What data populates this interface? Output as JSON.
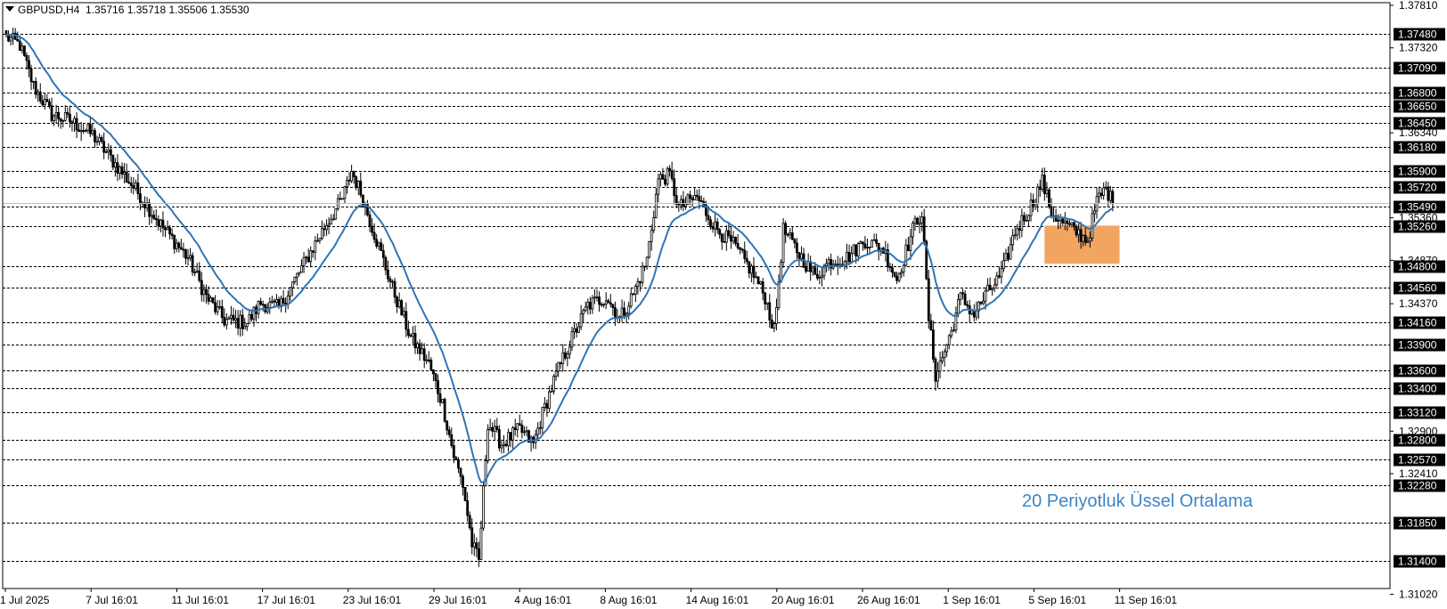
{
  "header": {
    "symbol": "GBPUSD,H4",
    "ohlc": "1.35716 1.35718 1.35506 1.35530"
  },
  "annotation": {
    "text": "20 Periyotluk Üssel Ortalama"
  },
  "colors": {
    "background": "#ffffff",
    "candle": "#000000",
    "ema_line": "#2e75b6",
    "annotation_text": "#3d85c6",
    "highlight_box": "#f2a561",
    "level_line": "#000000",
    "badge_bg": "#000000",
    "badge_text": "#ffffff"
  },
  "chart_data": {
    "type": "candlestick",
    "symbol": "GBPUSD",
    "timeframe": "H4",
    "ylim": [
      1.3125,
      1.3781
    ],
    "grid": false,
    "x_ticks": [
      "1 Jul 2025",
      "7 Jul 16:01",
      "11 Jul 16:01",
      "17 Jul 16:01",
      "23 Jul 16:01",
      "29 Jul 16:01",
      "4 Aug 16:01",
      "8 Aug 16:01",
      "14 Aug 16:01",
      "20 Aug 16:01",
      "26 Aug 16:01",
      "1 Sep 16:01",
      "5 Sep 16:01",
      "11 Sep 16:01"
    ],
    "y_ticks": [
      "1.37810",
      "1.37320",
      "1.36340",
      "1.35360",
      "1.34870",
      "1.34370",
      "1.32900",
      "1.32410",
      "1.31020"
    ],
    "level_labels": [
      "1.37480",
      "1.37090",
      "1.36800",
      "1.36650",
      "1.36450",
      "1.36180",
      "1.35900",
      "1.35720",
      "1.35490",
      "1.35260",
      "1.34800",
      "1.34560",
      "1.34160",
      "1.33900",
      "1.33600",
      "1.33400",
      "1.33120",
      "1.32800",
      "1.32570",
      "1.32280",
      "1.31850",
      "1.31400"
    ],
    "current_price": 1.3553,
    "close_path": [
      [
        0,
        1.3745
      ],
      [
        6,
        1.3735
      ],
      [
        12,
        1.3688
      ],
      [
        20,
        1.3655
      ],
      [
        28,
        1.3648
      ],
      [
        38,
        1.3632
      ],
      [
        48,
        1.3598
      ],
      [
        58,
        1.3565
      ],
      [
        68,
        1.3528
      ],
      [
        80,
        1.349
      ],
      [
        88,
        1.3445
      ],
      [
        96,
        1.3418
      ],
      [
        106,
        1.3415
      ],
      [
        112,
        1.3438
      ],
      [
        120,
        1.3432
      ],
      [
        130,
        1.3478
      ],
      [
        140,
        1.3525
      ],
      [
        148,
        1.3558
      ],
      [
        152,
        1.359
      ],
      [
        156,
        1.3565
      ],
      [
        162,
        1.3518
      ],
      [
        170,
        1.3455
      ],
      [
        178,
        1.3398
      ],
      [
        186,
        1.3368
      ],
      [
        192,
        1.3322
      ],
      [
        197,
        1.3262
      ],
      [
        201,
        1.3228
      ],
      [
        205,
        1.316
      ],
      [
        208,
        1.314
      ],
      [
        212,
        1.33
      ],
      [
        218,
        1.3275
      ],
      [
        226,
        1.3292
      ],
      [
        232,
        1.3275
      ],
      [
        236,
        1.331
      ],
      [
        242,
        1.3355
      ],
      [
        248,
        1.3392
      ],
      [
        256,
        1.3435
      ],
      [
        264,
        1.3445
      ],
      [
        270,
        1.342
      ],
      [
        276,
        1.3448
      ],
      [
        282,
        1.3488
      ],
      [
        287,
        1.358
      ],
      [
        292,
        1.3585
      ],
      [
        296,
        1.3548
      ],
      [
        304,
        1.356
      ],
      [
        312,
        1.3525
      ],
      [
        320,
        1.3505
      ],
      [
        328,
        1.3475
      ],
      [
        334,
        1.3445
      ],
      [
        338,
        1.3405
      ],
      [
        342,
        1.3522
      ],
      [
        348,
        1.3498
      ],
      [
        356,
        1.3468
      ],
      [
        362,
        1.3485
      ],
      [
        370,
        1.349
      ],
      [
        378,
        1.351
      ],
      [
        386,
        1.35
      ],
      [
        392,
        1.3465
      ],
      [
        400,
        1.353
      ],
      [
        403,
        1.3542
      ],
      [
        406,
        1.342
      ],
      [
        409,
        1.3355
      ],
      [
        412,
        1.3375
      ],
      [
        416,
        1.3405
      ],
      [
        420,
        1.3445
      ],
      [
        426,
        1.3425
      ],
      [
        432,
        1.345
      ],
      [
        438,
        1.347
      ],
      [
        444,
        1.352
      ],
      [
        450,
        1.3545
      ],
      [
        456,
        1.3578
      ],
      [
        460,
        1.3542
      ],
      [
        466,
        1.3528
      ],
      [
        472,
        1.3518
      ],
      [
        476,
        1.351
      ],
      [
        480,
        1.3555
      ],
      [
        484,
        1.357
      ],
      [
        487,
        1.3553
      ]
    ],
    "series": [
      {
        "name": "20 Periyotluk Üssel Ortalama",
        "type": "line",
        "indicator": "EMA",
        "period": 20
      }
    ],
    "highlight_zone": {
      "y_top": 1.3527,
      "y_bottom": 1.3483,
      "x_start_index": 457,
      "x_end_index": 490
    },
    "xlim_index": [
      0,
      490
    ]
  }
}
